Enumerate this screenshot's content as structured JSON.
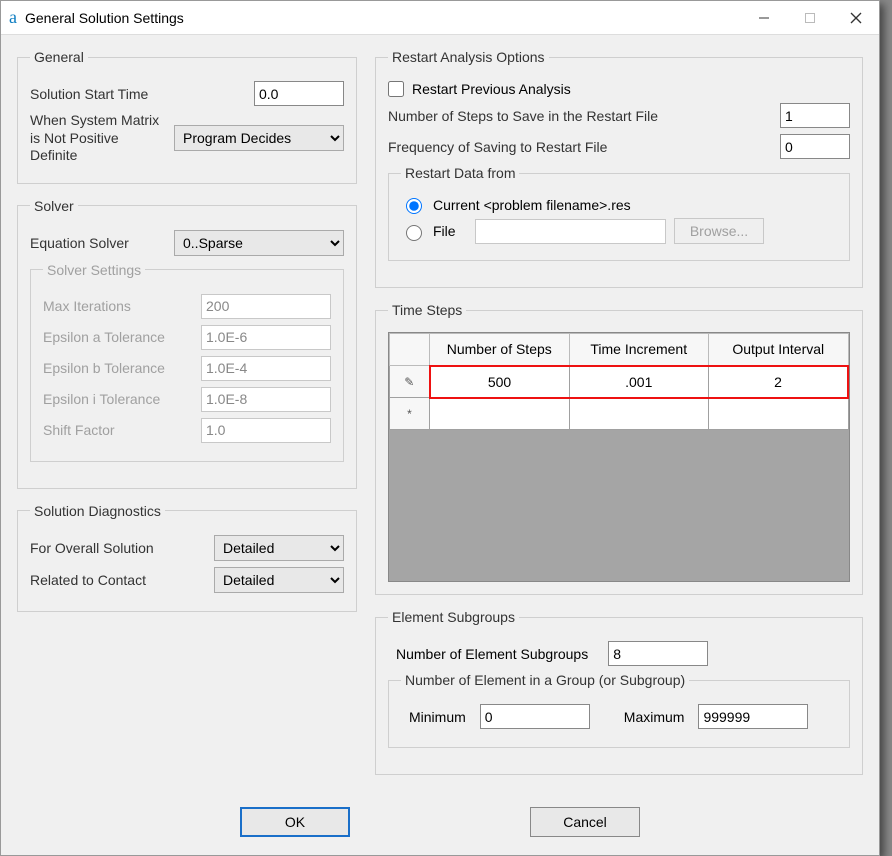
{
  "window": {
    "title": "General Solution Settings"
  },
  "general": {
    "legend": "General",
    "start_time_label": "Solution Start Time",
    "start_time_value": "0.0",
    "matrix_label": "When System Matrix is Not Positive Definite",
    "matrix_value": "Program Decides"
  },
  "solver": {
    "legend": "Solver",
    "eqn_label": "Equation Solver",
    "eqn_value": "0..Sparse",
    "settings_legend": "Solver Settings",
    "max_iter_label": "Max Iterations",
    "max_iter_value": "200",
    "eps_a_label": "Epsilon a Tolerance",
    "eps_a_value": "1.0E-6",
    "eps_b_label": "Epsilon b Tolerance",
    "eps_b_value": "1.0E-4",
    "eps_i_label": "Epsilon i Tolerance",
    "eps_i_value": "1.0E-8",
    "shift_label": "Shift Factor",
    "shift_value": "1.0"
  },
  "diag": {
    "legend": "Solution Diagnostics",
    "overall_label": "For Overall Solution",
    "overall_value": "Detailed",
    "contact_label": "Related to Contact",
    "contact_value": "Detailed"
  },
  "restart": {
    "legend": "Restart Analysis Options",
    "prev_label": "Restart Previous Analysis",
    "prev_checked": false,
    "steps_label": "Number of Steps to Save in the Restart File",
    "steps_value": "1",
    "freq_label": "Frequency of Saving to Restart File",
    "freq_value": "0",
    "data_legend": "Restart Data from",
    "opt_current": "Current <problem filename>.res",
    "opt_file": "File",
    "browse": "Browse..."
  },
  "timesteps": {
    "legend": "Time Steps",
    "headers": [
      "Number of Steps",
      "Time Increment",
      "Output Interval"
    ],
    "rows": [
      {
        "marker": "✎",
        "n": "500",
        "dt": ".001",
        "out": "2"
      },
      {
        "marker": "*",
        "n": "",
        "dt": "",
        "out": ""
      }
    ]
  },
  "subgroups": {
    "legend": "Element Subgroups",
    "num_label": "Number of Element Subgroups",
    "num_value": "8",
    "group_legend": "Number of Element in a Group (or Subgroup)",
    "min_label": "Minimum",
    "min_value": "0",
    "max_label": "Maximum",
    "max_value": "999999"
  },
  "buttons": {
    "ok": "OK",
    "cancel": "Cancel"
  }
}
